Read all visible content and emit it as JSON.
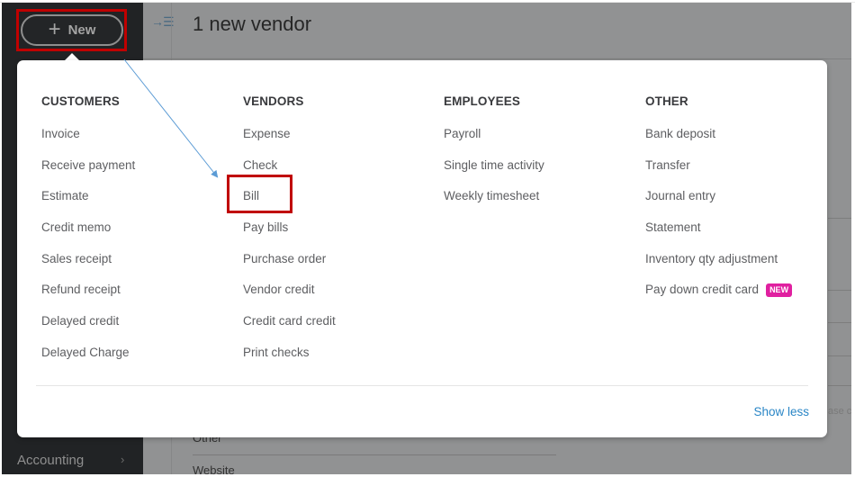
{
  "sidebar": {
    "new_button_label": "New",
    "new_button_icon": "plus-icon",
    "bottom_item_label": "Accounting"
  },
  "header": {
    "title": "1 new vendor",
    "collapse_icon": "collapse-menu-icon"
  },
  "background": {
    "field_label_other": "Other",
    "field_label_website": "Website",
    "hint_fragment": "ase c"
  },
  "popup": {
    "columns": [
      {
        "heading": "CUSTOMERS",
        "items": [
          "Invoice",
          "Receive payment",
          "Estimate",
          "Credit memo",
          "Sales receipt",
          "Refund receipt",
          "Delayed credit",
          "Delayed Charge"
        ]
      },
      {
        "heading": "VENDORS",
        "items": [
          "Expense",
          "Check",
          "Bill",
          "Pay bills",
          "Purchase order",
          "Vendor credit",
          "Credit card credit",
          "Print checks"
        ]
      },
      {
        "heading": "EMPLOYEES",
        "items": [
          "Payroll",
          "Single time activity",
          "Weekly timesheet"
        ]
      },
      {
        "heading": "OTHER",
        "items": [
          "Bank deposit",
          "Transfer",
          "Journal entry",
          "Statement",
          "Inventory qty adjustment",
          "Pay down credit card"
        ]
      }
    ],
    "new_badge": "NEW",
    "show_less_label": "Show less"
  },
  "annotations": {
    "highlight_color": "#c00000",
    "arrow_color": "#5b9bd5"
  },
  "colors": {
    "sidebar_bg": "#212325",
    "overlay_bg": "#919293",
    "link": "#2a86c6",
    "badge": "#e020a0"
  }
}
